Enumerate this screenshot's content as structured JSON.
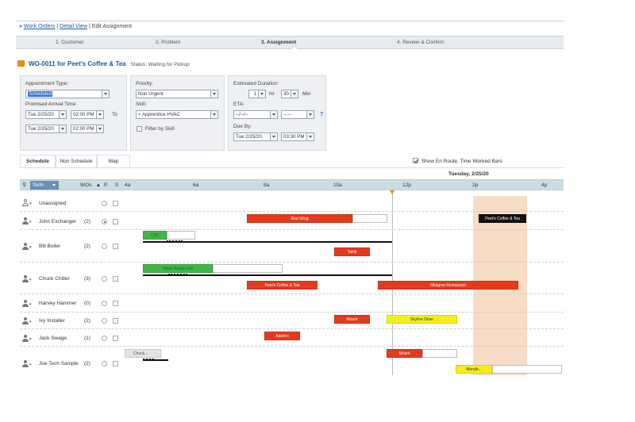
{
  "breadcrumb": {
    "arrow": "»",
    "link1": "Work Orders",
    "link2": "Detail View",
    "current": "| Edit Assignment"
  },
  "steps": [
    "1. Customer",
    "2. Problem",
    "3. Assignment",
    "4. Review & Confirm"
  ],
  "work_order": {
    "title": "WO-0011 for Peet's Coffee & Tea",
    "status": "Status: Waiting for Pickup"
  },
  "form": {
    "appointment_type_label": "Appointment Type:",
    "appointment_type_value": "Scheduled",
    "promised_arrival_label": "Promised Arrival Time:",
    "from_date": "Tue 2/25/20",
    "from_time": "02:00 PM",
    "to_label": "To",
    "to_date": "Tue 2/25/20",
    "to_time": "02:00 PM",
    "priority_label": "Priority:",
    "priority_value": "Non Urgent",
    "skill_label": "Skill:",
    "skill_value": "+ Apprentice HVAC",
    "filter_by_skill_label": "Filter by Skill",
    "est_duration_label": "Estimated Duration:",
    "hours_value": "1",
    "hr_label": "Hr",
    "minutes_value": "30",
    "min_label": "Min",
    "eta_label": "ETA:",
    "eta_date": "--/--/--",
    "eta_time": "--:--",
    "help": "?",
    "due_by_label": "Due By:",
    "due_date": "Tue 2/25/20",
    "due_time": "03:30 PM"
  },
  "tabs": [
    "Schedule",
    "Non Schedule",
    "Map"
  ],
  "show_en_route_label": "Show En Route, Time Worked Bars",
  "show_en_route_checked": true,
  "date_header": "Tuesday, 2/25/20",
  "grid_header": {
    "tech": "Tech",
    "wos": "WOs",
    "p": "P",
    "s": "S",
    "hours": [
      "4a",
      "6a",
      "8a",
      "10a",
      "12p",
      "2p",
      "4p"
    ]
  },
  "rows": [
    {
      "name": "Unassigned",
      "count": ""
    },
    {
      "name": "John Exchanger",
      "count": "(2)"
    },
    {
      "name": "Bill Boiler",
      "count": "(2)"
    },
    {
      "name": "Chuck Chiller",
      "count": "(3)"
    },
    {
      "name": "Harvey Hammer",
      "count": "(0)"
    },
    {
      "name": "Ivy Installer",
      "count": "(2)"
    },
    {
      "name": "Jack Swage",
      "count": "(1)"
    },
    {
      "name": "Joe Tech Sample",
      "count": "(2)"
    }
  ],
  "bars": {
    "john_red": "Red Wing",
    "john_black": "Peet's Coffee & Tea",
    "bill_green": "CSZ",
    "bill_red": "Tahiti",
    "chuck_green": "Hawk Realty Frio",
    "chuck_red1": "Peet's Coffee & Tea",
    "chuck_red2": "Milagros Restaurant",
    "ivy_red": "Mount",
    "ivy_yellow": "Skyline Diner",
    "jack_red": "Adam's",
    "joe_grey": "Chuck...",
    "joe_red": "Mount",
    "joe_yellow": "Moralb..."
  },
  "colors": {
    "accent_blue": "#1a5a9a",
    "bar_red": "#e43b1c",
    "bar_green": "#3fb84a",
    "bar_yellow": "#f6ee1a",
    "highlight_column": "#f7dcc6",
    "grid_header": "#c9dde2"
  }
}
